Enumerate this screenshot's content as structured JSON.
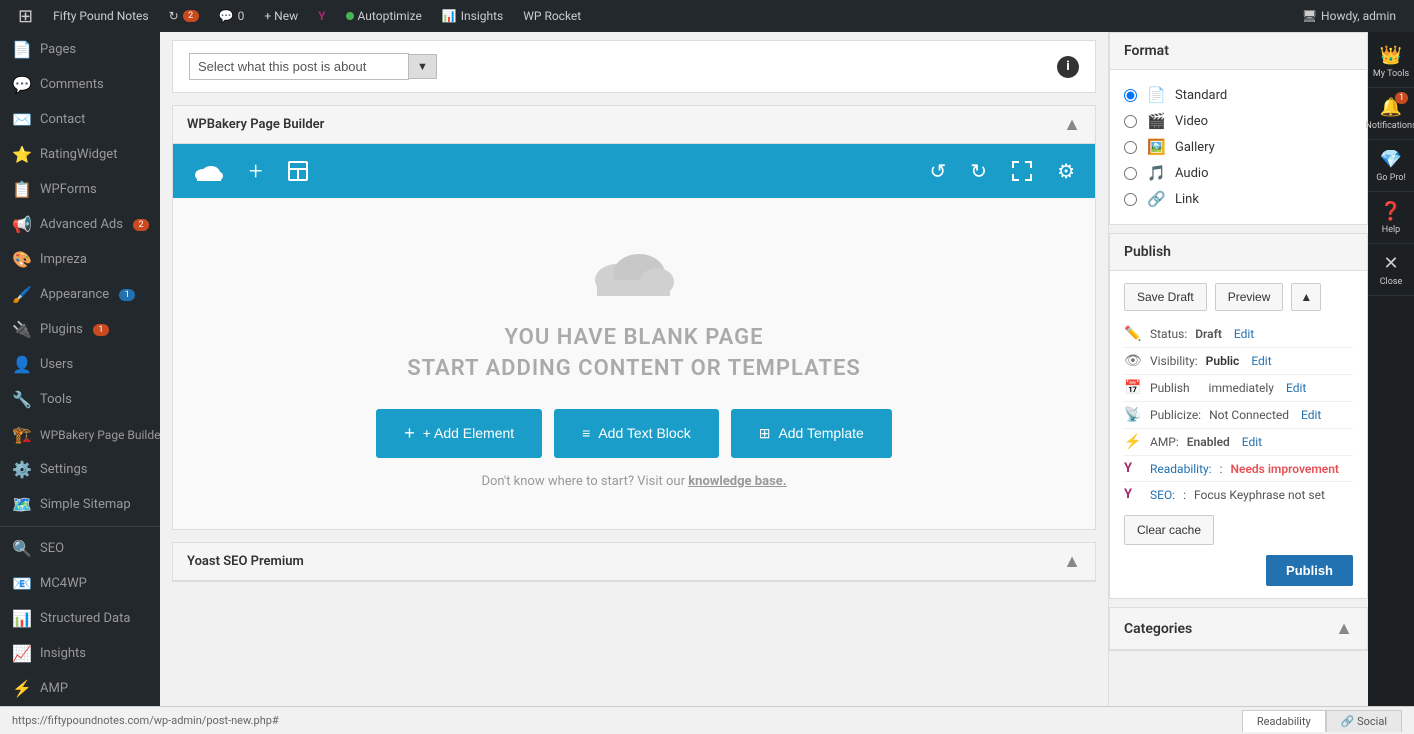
{
  "adminbar": {
    "site_name": "Fifty Pound Notes",
    "updates_count": "2",
    "comments_count": "0",
    "new_label": "+ New",
    "autoptimize_label": "Autoptimize",
    "insights_label": "Insights",
    "wp_rocket_label": "WP Rocket",
    "howdy_label": "Howdy, admin"
  },
  "sidebar": {
    "items": [
      {
        "id": "pages",
        "label": "Pages",
        "icon": "📄",
        "badge": null
      },
      {
        "id": "comments",
        "label": "Comments",
        "icon": "💬",
        "badge": null
      },
      {
        "id": "contact",
        "label": "Contact",
        "icon": "✉️",
        "badge": null
      },
      {
        "id": "ratingwidget",
        "label": "RatingWidget",
        "icon": "⭐",
        "badge": null
      },
      {
        "id": "wpforms",
        "label": "WPForms",
        "icon": "📋",
        "badge": null
      },
      {
        "id": "advanced-ads",
        "label": "Advanced Ads",
        "icon": "📢",
        "badge": "2"
      },
      {
        "id": "impreza",
        "label": "Impreza",
        "icon": "🎨",
        "badge": null
      },
      {
        "id": "appearance",
        "label": "Appearance",
        "icon": "🖌️",
        "badge": "1"
      },
      {
        "id": "plugins",
        "label": "Plugins",
        "icon": "🔌",
        "badge": "1"
      },
      {
        "id": "users",
        "label": "Users",
        "icon": "👤",
        "badge": null
      },
      {
        "id": "tools",
        "label": "Tools",
        "icon": "🔧",
        "badge": null
      },
      {
        "id": "wpbakery",
        "label": "WPBakery Page Builder",
        "icon": "🏗️",
        "badge": null
      },
      {
        "id": "settings",
        "label": "Settings",
        "icon": "⚙️",
        "badge": null
      },
      {
        "id": "simple-sitemap",
        "label": "Simple Sitemap",
        "icon": "🗺️",
        "badge": null
      },
      {
        "id": "seo",
        "label": "SEO",
        "icon": "🔍",
        "badge": null
      },
      {
        "id": "mc4wp",
        "label": "MC4WP",
        "icon": "📧",
        "badge": null
      },
      {
        "id": "structured-data",
        "label": "Structured Data",
        "icon": "📊",
        "badge": null
      },
      {
        "id": "insights",
        "label": "Insights",
        "icon": "📈",
        "badge": null
      },
      {
        "id": "amp",
        "label": "AMP",
        "icon": "⚡",
        "badge": null
      }
    ]
  },
  "post_about": {
    "select_placeholder": "Select what this post is about",
    "info_icon": "i"
  },
  "wpbakery": {
    "section_title": "WPBakery Page Builder",
    "toolbar_buttons": [
      "cloud",
      "plus",
      "layout"
    ],
    "blank_title_line1": "YOU HAVE BLANK PAGE",
    "blank_title_line2": "START ADDING CONTENT OR TEMPLATES",
    "add_element_label": "+ Add Element",
    "add_text_block_label": "Add Text Block",
    "add_template_label": "Add Template",
    "hint_text": "Don't know where to start? Visit our",
    "hint_link": "knowledge base."
  },
  "format": {
    "section_title": "Format",
    "options": [
      {
        "id": "standard",
        "label": "Standard",
        "selected": true,
        "icon": "📄"
      },
      {
        "id": "video",
        "label": "Video",
        "selected": false,
        "icon": "🎬"
      },
      {
        "id": "gallery",
        "label": "Gallery",
        "selected": false,
        "icon": "🖼️"
      },
      {
        "id": "audio",
        "label": "Audio",
        "selected": false,
        "icon": "🎵"
      },
      {
        "id": "link",
        "label": "Link",
        "selected": false,
        "icon": "🔗"
      }
    ]
  },
  "publish": {
    "section_title": "Publish",
    "save_draft_label": "Save Draft",
    "preview_label": "Preview",
    "status_label": "Status:",
    "status_value": "Draft",
    "status_edit": "Edit",
    "visibility_label": "Visibility:",
    "visibility_value": "Public",
    "visibility_edit": "Edit",
    "publish_time_label": "Publish",
    "publish_time_value": "immediately",
    "publish_time_edit": "Edit",
    "publicize_label": "Publicize:",
    "publicize_value": "Not Connected",
    "publicize_edit": "Edit",
    "amp_label": "AMP:",
    "amp_value": "Enabled",
    "amp_edit": "Edit",
    "readability_label": "Readability:",
    "readability_value": "Needs improvement",
    "seo_label": "SEO:",
    "seo_value": "Focus Keyphrase not set",
    "clear_cache_label": "Clear cache",
    "publish_label": "Publish"
  },
  "yoast": {
    "section_title": "Yoast SEO Premium"
  },
  "categories": {
    "section_title": "Categories"
  },
  "tools_panel": {
    "my_tools_label": "My Tools",
    "notifications_label": "Notifications",
    "notifications_badge": "1",
    "go_pro_label": "Go Pro!",
    "help_label": "Help",
    "close_label": "Close"
  },
  "bottom_bar": {
    "url": "https://fiftypoundnotes.com/wp-admin/post-new.php#",
    "tab_readability": "Readability",
    "tab_social": "Social"
  },
  "colors": {
    "wpbakery_blue": "#1a9ec9",
    "admin_blue": "#2271b1",
    "sidebar_bg": "#23282d",
    "error_red": "#e65054"
  }
}
